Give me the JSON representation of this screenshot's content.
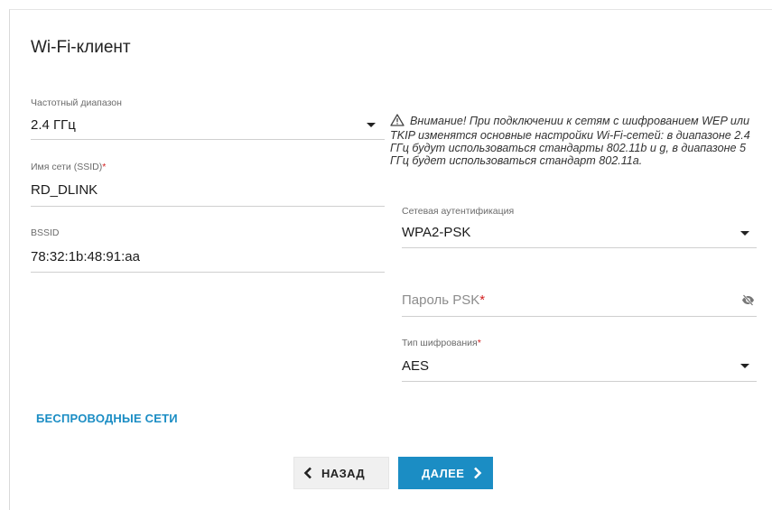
{
  "page": {
    "title": "Wi-Fi-клиент"
  },
  "left": {
    "band": {
      "label": "Частотный диапазон",
      "value": "2.4 ГГц"
    },
    "ssid": {
      "label": "Имя сети (SSID)",
      "required_mark": "*",
      "value": "RD_DLINK"
    },
    "bssid": {
      "label": "BSSID",
      "value": "78:32:1b:48:91:aa"
    }
  },
  "warning": {
    "icon": "warning-triangle-icon",
    "text": "Внимание! При подключении к сетям с шифрованием WEP или TKIP изменятся основные настройки Wi-Fi-сетей: в диапазоне 2.4 ГГц будут использоваться стандарты 802.11b и g, в диапазоне 5 ГГц будет использоваться стандарт 802.11a."
  },
  "right": {
    "auth": {
      "label": "Сетевая аутентификация",
      "value": "WPA2-PSK"
    },
    "psk": {
      "placeholder": "Пароль PSK",
      "required_mark": "*",
      "visibility_icon": "eye-off-icon"
    },
    "cipher": {
      "label": "Тип шифрования",
      "required_mark": "*",
      "value": "AES"
    }
  },
  "links": {
    "wireless_networks": "БЕСПРОВОДНЫЕ СЕТИ"
  },
  "buttons": {
    "back": "НАЗАД",
    "next": "ДАЛЕЕ"
  },
  "colors": {
    "accent": "#1b8dc4",
    "required": "#d21f1f",
    "back_button_bg": "#f0f0f0"
  }
}
